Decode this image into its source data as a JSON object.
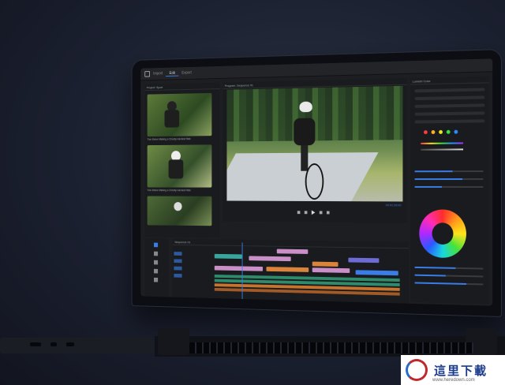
{
  "app": {
    "tabs": [
      "Import",
      "Edit",
      "Export"
    ],
    "active_tab": "Edit"
  },
  "project_panel": {
    "title": "Project: Sport",
    "thumbnails": [
      {
        "caption": "Two Brave Making a Charity Hardest Ride"
      },
      {
        "caption": "Two Brave Making a Charity Hardest Ride"
      },
      {
        "caption": "Clip"
      }
    ]
  },
  "program_monitor": {
    "title": "Program: Sequence 01",
    "timecode": "00:01:26:00"
  },
  "lumetri": {
    "title": "Lumetri Color"
  },
  "timeline": {
    "title": "Sequence 01"
  },
  "watermark": {
    "title": "這里下載",
    "url": "www.heredown.com"
  },
  "colors": {
    "accent": "#3b7de8",
    "clip_teal": "#3aa59c",
    "clip_pink": "#c98fc6",
    "clip_orange": "#d9843a",
    "clip_purple": "#6e6bd6"
  }
}
